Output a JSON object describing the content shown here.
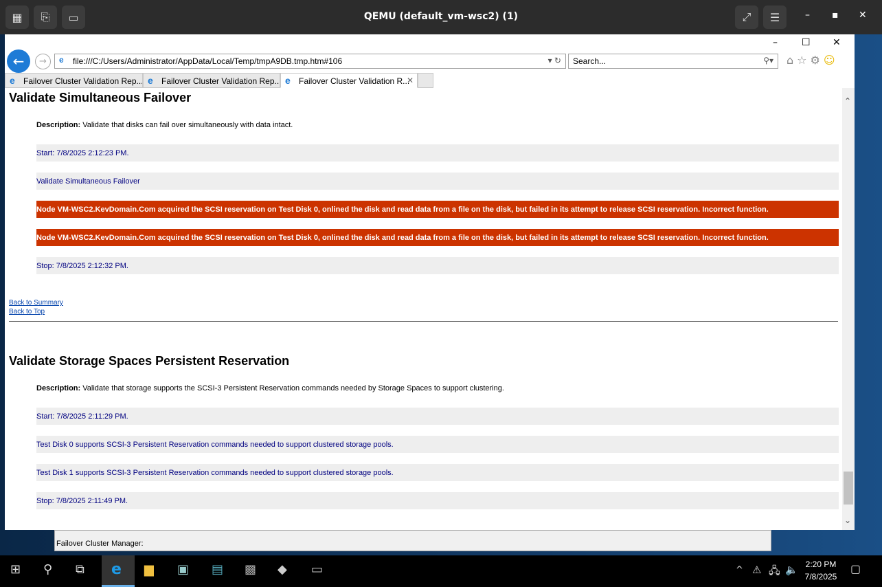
{
  "qemu": {
    "title": "QEMU (default_vm-wsc2) (1)"
  },
  "browser": {
    "url": "file:///C:/Users/Administrator/AppData/Local/Temp/tmpA9DB.tmp.htm#106",
    "search_placeholder": "Search...",
    "tabs": [
      {
        "label": "Failover Cluster Validation Rep..."
      },
      {
        "label": "Failover Cluster Validation Rep..."
      },
      {
        "label": "Failover Cluster Validation R..."
      }
    ]
  },
  "sections": [
    {
      "title": "Validate Simultaneous Failover",
      "desc_label": "Description:",
      "desc": " Validate that disks can fail over simultaneously with data intact.",
      "rows": [
        {
          "text": "Start: 7/8/2025 2:12:23 PM."
        },
        {
          "text": "Validate Simultaneous Failover"
        },
        {
          "text": "Node VM-WSC2.KevDomain.Com acquired the SCSI reservation on Test Disk 0, onlined the disk and read data from a file on the disk, but failed in its attempt to release SCSI reservation. Incorrect function."
        },
        {
          "text": "Node VM-WSC2.KevDomain.Com acquired the SCSI reservation on Test Disk 0, onlined the disk and read data from a file on the disk, but failed in its attempt to release SCSI reservation. Incorrect function."
        },
        {
          "text": "Stop: 7/8/2025 2:12:32 PM."
        }
      ],
      "back_summary": "Back to Summary",
      "back_top": "Back to Top"
    },
    {
      "title": "Validate Storage Spaces Persistent Reservation",
      "desc_label": "Description:",
      "desc": " Validate that storage supports the SCSI-3 Persistent Reservation commands needed by Storage Spaces to support clustering.",
      "rows": [
        {
          "text": "Start: 7/8/2025 2:11:29 PM."
        },
        {
          "text": "Test Disk 0 supports SCSI-3 Persistent Reservation commands needed to support clustered storage pools."
        },
        {
          "text": "Test Disk 1 supports SCSI-3 Persistent Reservation commands needed to support clustered storage pools."
        },
        {
          "text": "Stop: 7/8/2025 2:11:49 PM."
        }
      ]
    }
  ],
  "fcm": {
    "status": "Failover Cluster Manager:"
  },
  "taskbar": {
    "time": "2:20 PM",
    "date": "7/8/2025"
  },
  "colors": {
    "error": "#cc3300",
    "row": "#eeeeee",
    "text": "#000080"
  }
}
